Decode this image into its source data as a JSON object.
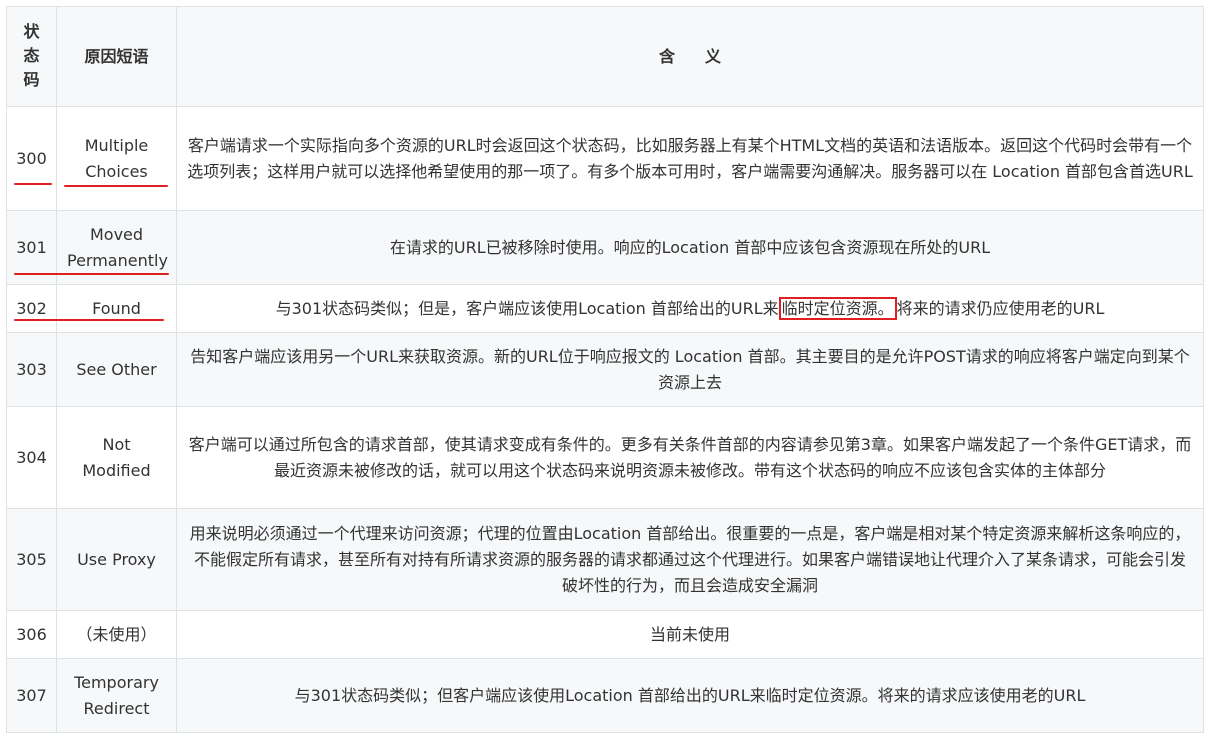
{
  "table": {
    "headers": {
      "code": "状态码",
      "reason": "原因短语",
      "meaning_part1": "含",
      "meaning_part2": "义"
    },
    "rows": [
      {
        "code": "300",
        "reason": "Multiple Choices",
        "meaning": "客户端请求一个实际指向多个资源的URL时会返回这个状态码，比如服务器上有某个HTML文档的英语和法语版本。返回这个代码时会带有一个选项列表；这样用户就可以选择他希望使用的那一项了。有多个版本可用时，客户端需要沟通解决。服务器可以在 Location 首部包含首选URL"
      },
      {
        "code": "301",
        "reason": "Moved Permanently",
        "meaning": "在请求的URL已被移除时使用。响应的Location 首部中应该包含资源现在所处的URL"
      },
      {
        "code": "302",
        "reason": "Found",
        "meaning_before": "与301状态码类似；但是，客户端应该使用Location 首部给出的URL来",
        "meaning_highlight": "临时定位资源。",
        "meaning_after": "将来的请求仍应使用老的URL"
      },
      {
        "code": "303",
        "reason": "See Other",
        "meaning": "告知客户端应该用另一个URL来获取资源。新的URL位于响应报文的 Location 首部。其主要目的是允许POST请求的响应将客户端定向到某个资源上去"
      },
      {
        "code": "304",
        "reason": "Not Modified",
        "meaning": "客户端可以通过所包含的请求首部，使其请求变成有条件的。更多有关条件首部的内容请参见第3章。如果客户端发起了一个条件GET请求，而最近资源未被修改的话，就可以用这个状态码来说明资源未被修改。带有这个状态码的响应不应该包含实体的主体部分"
      },
      {
        "code": "305",
        "reason": "Use Proxy",
        "meaning": "用来说明必须通过一个代理来访问资源；代理的位置由Location 首部给出。很重要的一点是，客户端是相对某个特定资源来解析这条响应的，不能假定所有请求，甚至所有对持有所请求资源的服务器的请求都通过这个代理进行。如果客户端错误地让代理介入了某条请求，可能会引发破坏性的行为，而且会造成安全漏洞"
      },
      {
        "code": "306",
        "reason": "（未使用）",
        "meaning": "当前未使用"
      },
      {
        "code": "307",
        "reason": "Temporary Redirect",
        "meaning": "与301状态码类似；但客户端应该使用Location 首部给出的URL来临时定位资源。将来的请求应该使用老的URL"
      }
    ]
  },
  "annotations": {
    "mark_color": "#e02020"
  }
}
